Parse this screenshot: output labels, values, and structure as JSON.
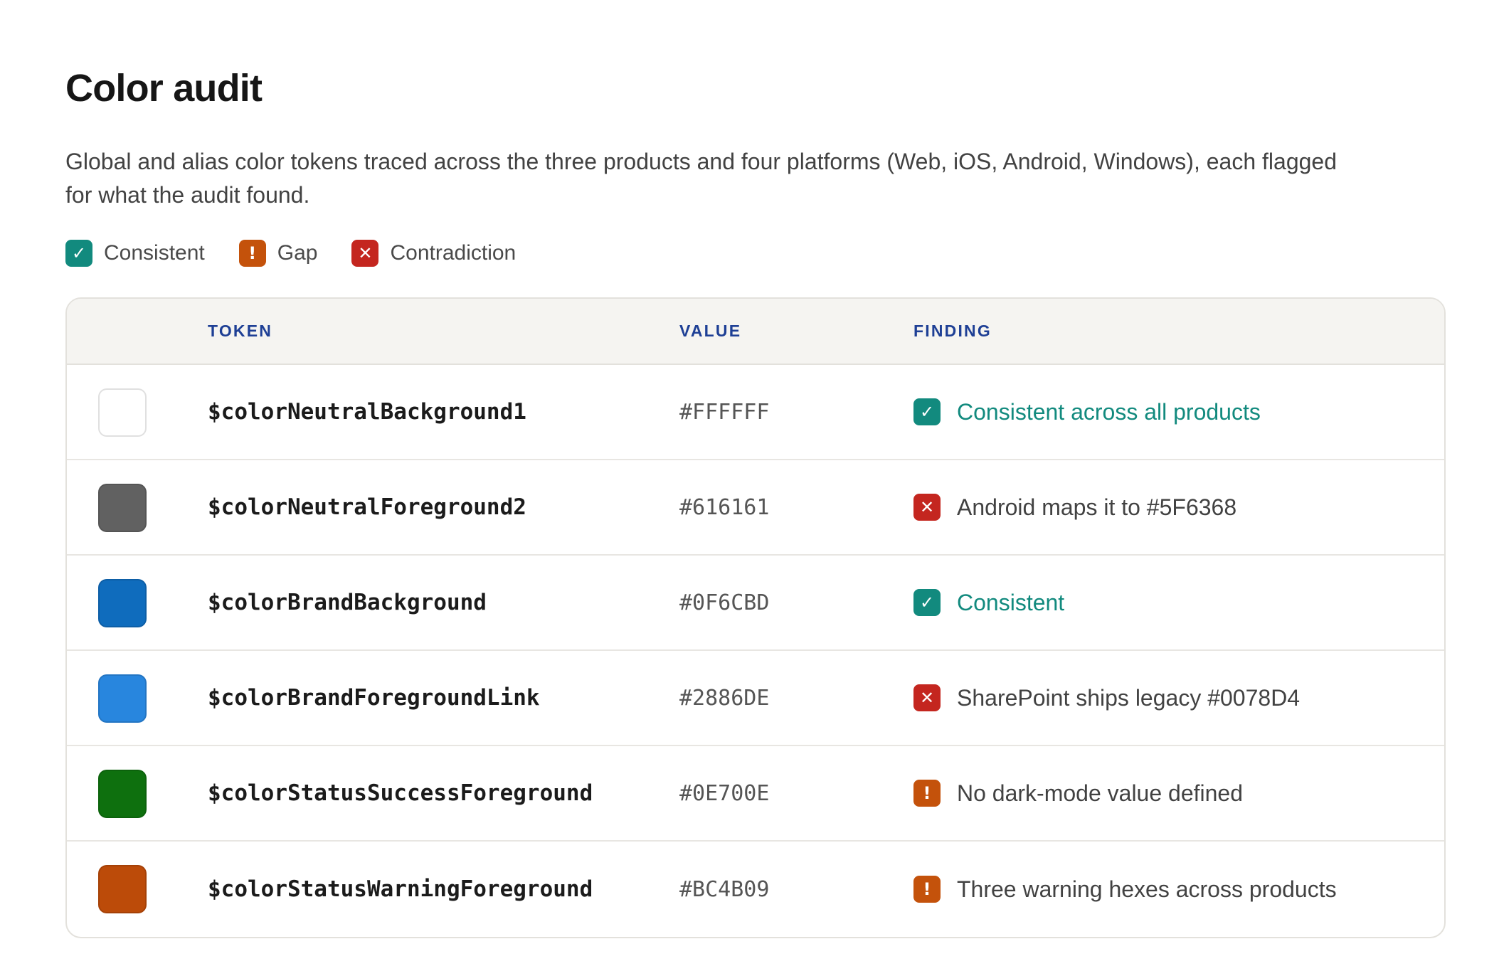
{
  "header": {
    "title": "Color audit",
    "description": "Global and alias color tokens traced across the three products and four platforms (Web, iOS, Android, Windows), each flagged for what the audit found."
  },
  "legend": [
    {
      "status": "consistent",
      "label": "Consistent",
      "icon": "check-icon"
    },
    {
      "status": "gap",
      "label": "Gap",
      "icon": "exclamation-icon"
    },
    {
      "status": "contradiction",
      "label": "Contradiction",
      "icon": "x-icon"
    }
  ],
  "table": {
    "columns": {
      "swatch": "",
      "token": "TOKEN",
      "value": "VALUE",
      "finding": "FINDING"
    },
    "rows": [
      {
        "token": "$colorNeutralBackground1",
        "value": "#FFFFFF",
        "swatch_color": "#FFFFFF",
        "status": "consistent",
        "finding": "Consistent across all products"
      },
      {
        "token": "$colorNeutralForeground2",
        "value": "#616161",
        "swatch_color": "#616161",
        "status": "contradiction",
        "finding": "Android maps it to #5F6368"
      },
      {
        "token": "$colorBrandBackground",
        "value": "#0F6CBD",
        "swatch_color": "#0F6CBD",
        "status": "consistent",
        "finding": "Consistent"
      },
      {
        "token": "$colorBrandForegroundLink",
        "value": "#2886DE",
        "swatch_color": "#2886DE",
        "status": "contradiction",
        "finding": "SharePoint ships legacy #0078D4"
      },
      {
        "token": "$colorStatusSuccessForeground",
        "value": "#0E700E",
        "swatch_color": "#0E700E",
        "status": "gap",
        "finding": "No dark-mode value defined"
      },
      {
        "token": "$colorStatusWarningForeground",
        "value": "#BC4B09",
        "swatch_color": "#BC4B09",
        "status": "gap",
        "finding": "Three warning hexes across products"
      }
    ]
  },
  "colors": {
    "consistent": "#128A7E",
    "gap": "#C4520B",
    "contradiction": "#C4261F",
    "header_text": "#1E3F95"
  }
}
